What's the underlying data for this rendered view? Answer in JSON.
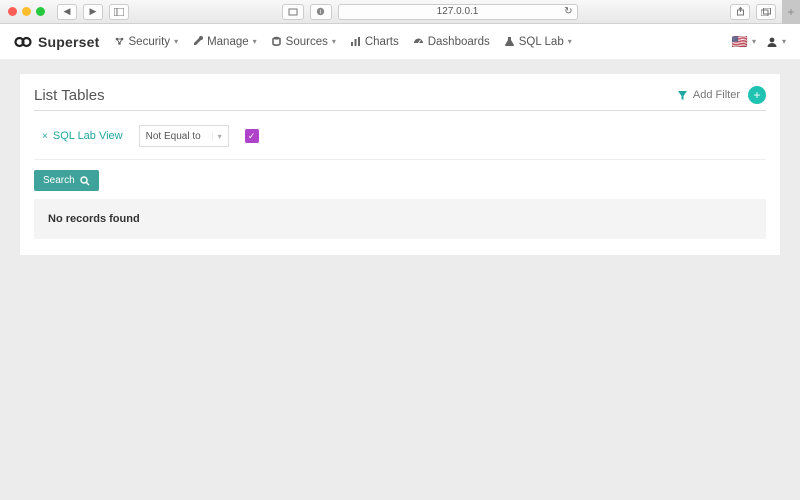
{
  "browser": {
    "url": "127.0.0.1"
  },
  "brand": {
    "name": "Superset"
  },
  "nav": {
    "security": "Security",
    "manage": "Manage",
    "sources": "Sources",
    "charts": "Charts",
    "dashboards": "Dashboards",
    "sqllab": "SQL Lab"
  },
  "page": {
    "title": "List Tables",
    "add_filter": "Add Filter"
  },
  "filter": {
    "chip_label": "SQL Lab View",
    "operator": "Not Equal to",
    "checkbox_checked": true
  },
  "actions": {
    "search": "Search"
  },
  "results": {
    "empty": "No records found"
  },
  "colors": {
    "teal": "#20a7a0",
    "teal_btn": "#3fa39b",
    "purple": "#b041c9"
  }
}
